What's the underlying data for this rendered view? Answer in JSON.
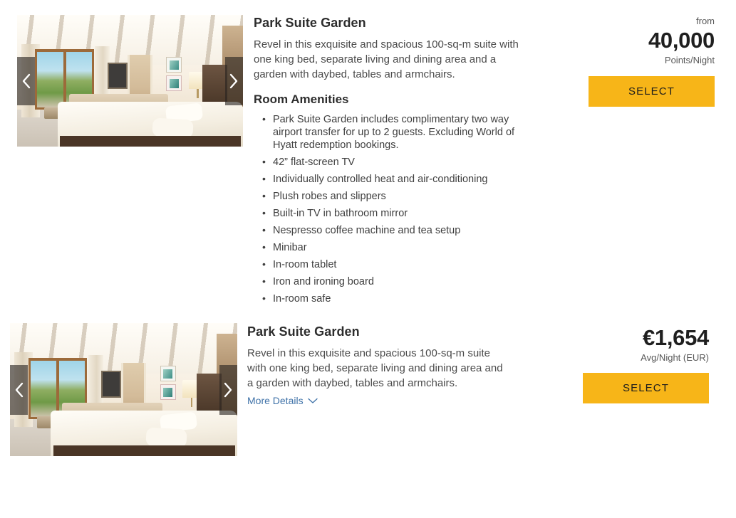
{
  "theme": {
    "accent": "#f7b518",
    "link": "#3f72a8",
    "text": "#3f3f3f",
    "heading": "#2d2d2d",
    "page_background": "#ffffff"
  },
  "rooms": [
    {
      "title": "Park Suite Garden",
      "description": "Revel in this exquisite and spacious 100-sq-m suite with one king bed, separate living and dining area and a garden with daybed, tables and armchairs.",
      "amenities_heading": "Room Amenities",
      "amenities": [
        "Park Suite Garden includes complimentary two way airport transfer for up to 2 guests. Excluding World of Hyatt redemption bookings.",
        "42” flat-screen TV",
        "Individually controlled heat and air-conditioning",
        "Plush robes and slippers",
        "Built-in TV in bathroom mirror",
        "Nespresso coffee machine and tea setup",
        "Minibar",
        "In-room tablet",
        "Iron and ironing board",
        "In-room safe"
      ],
      "price": {
        "prefix": "from",
        "amount": "40,000",
        "unit": "Points/Night"
      },
      "select_label": "SELECT",
      "gallery": {
        "prev_label": "Previous image",
        "next_label": "Next image",
        "image_alt": "Park Suite Garden bedroom with king bed and open doors to the garden"
      }
    },
    {
      "title": "Park Suite Garden",
      "description": "Revel in this exquisite and spacious 100-sq-m suite with one king bed, separate living and dining area and a garden with daybed, tables and armchairs.",
      "more_details_label": "More Details",
      "price": {
        "prefix": "",
        "amount": "€1,654",
        "unit": "Avg/Night (EUR)"
      },
      "select_label": "SELECT",
      "gallery": {
        "prev_label": "Previous image",
        "next_label": "Next image",
        "image_alt": "Park Suite Garden bedroom with king bed and open doors to the garden"
      }
    }
  ]
}
